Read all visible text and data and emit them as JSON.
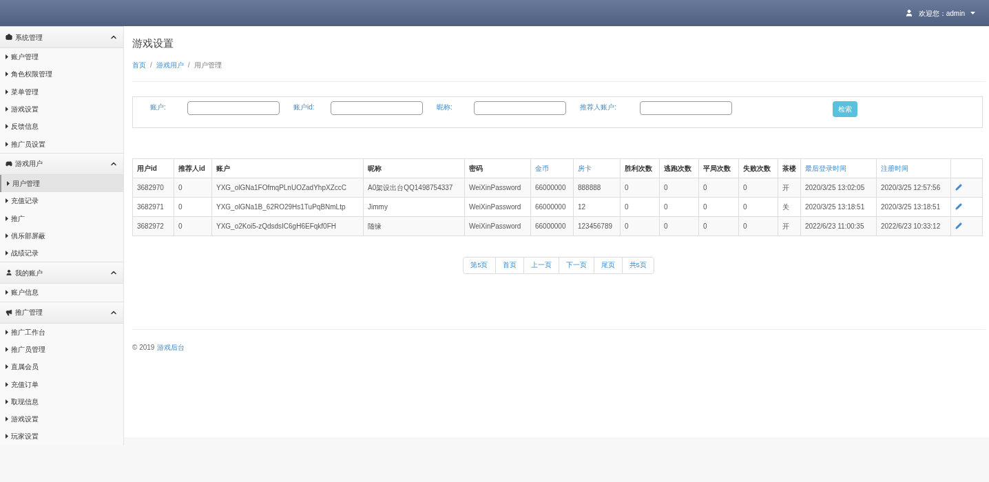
{
  "header": {
    "user": "欢迎您：admin"
  },
  "sidebar": [
    {
      "title": "系统管理",
      "expanded": true,
      "items": [
        {
          "label": "账户管理",
          "selected": false
        },
        {
          "label": "角色权限管理",
          "selected": false
        },
        {
          "label": "菜单管理",
          "selected": false
        },
        {
          "label": "游戏设置",
          "selected": false
        },
        {
          "label": "反馈信息",
          "selected": false
        },
        {
          "label": "推广员设置",
          "selected": false
        }
      ]
    },
    {
      "title": "游戏用户",
      "expanded": true,
      "items": [
        {
          "label": "用户管理",
          "selected": true
        },
        {
          "label": "充值记录",
          "selected": false
        },
        {
          "label": "推广",
          "selected": false
        },
        {
          "label": "俱乐部屏蔽",
          "selected": false
        },
        {
          "label": "战绩记录",
          "selected": false
        }
      ]
    },
    {
      "title": "我的账户",
      "expanded": true,
      "items": [
        {
          "label": "账户信息",
          "selected": false
        }
      ]
    },
    {
      "title": "推广管理",
      "expanded": true,
      "items": [
        {
          "label": "推广工作台",
          "selected": false
        },
        {
          "label": "推广员管理",
          "selected": false
        },
        {
          "label": "直属会员",
          "selected": false
        },
        {
          "label": "充值订单",
          "selected": false
        },
        {
          "label": "取现信息",
          "selected": false
        },
        {
          "label": "游戏设置",
          "selected": false
        },
        {
          "label": "玩家设置",
          "selected": false
        }
      ]
    }
  ],
  "page_title": "游戏设置",
  "breadcrumb_separator": "/",
  "breadcrumb": [
    {
      "label": "首页",
      "kind": "link"
    },
    {
      "label": "游戏用户",
      "kind": "link"
    },
    {
      "label": "用户管理",
      "kind": "current"
    }
  ],
  "search": {
    "fields": [
      {
        "label": "账户:"
      },
      {
        "label": "账户id:"
      },
      {
        "label": "昵称:"
      },
      {
        "label": "推荐人账户:"
      }
    ],
    "button": "检索"
  },
  "table": {
    "columns": [
      {
        "label": "用户id",
        "sortable": false
      },
      {
        "label": "推荐人id",
        "sortable": false
      },
      {
        "label": "账户",
        "sortable": false
      },
      {
        "label": "昵称",
        "sortable": false
      },
      {
        "label": "密码",
        "sortable": false
      },
      {
        "label": "金币",
        "sortable": true
      },
      {
        "label": "房卡",
        "sortable": true
      },
      {
        "label": "胜利次数",
        "sortable": false
      },
      {
        "label": "逃跑次数",
        "sortable": false
      },
      {
        "label": "平局次数",
        "sortable": false
      },
      {
        "label": "失败次数",
        "sortable": false
      },
      {
        "label": "茶楼",
        "sortable": false
      },
      {
        "label": "最后登录时间",
        "sortable": true
      },
      {
        "label": "注册时间",
        "sortable": true
      }
    ],
    "rows": [
      [
        "3682970",
        "0",
        "YXG_olGNa1FOfmqPLnUOZadYhpXZccC",
        "A0架设出台QQ1498754337",
        "WeiXinPassword",
        "66000000",
        "888888",
        "0",
        "0",
        "0",
        "0",
        "开",
        "2020/3/25 13:02:05",
        "2020/3/25 12:57:56"
      ],
      [
        "3682971",
        "0",
        "YXG_olGNa1B_62RO29Hs1TuPqBNmLtp",
        "Jimmy",
        "WeiXinPassword",
        "66000000",
        "12",
        "0",
        "0",
        "0",
        "0",
        "关",
        "2020/3/25 13:18:51",
        "2020/3/25 13:18:51"
      ],
      [
        "3682972",
        "0",
        "YXG_o2Koi5-zQdsdsIC6gH6EFqkf0FH",
        "随缘",
        "WeiXinPassword",
        "66000000",
        "123456789",
        "0",
        "0",
        "0",
        "0",
        "开",
        "2022/6/23 11:00:35",
        "2022/6/23 10:33:12"
      ]
    ]
  },
  "pagination": [
    "第5页",
    "首页",
    "上一页",
    "下一页",
    "尾页",
    "共5页"
  ],
  "footer": {
    "copyright": "© 2019",
    "link": "游戏后台"
  }
}
